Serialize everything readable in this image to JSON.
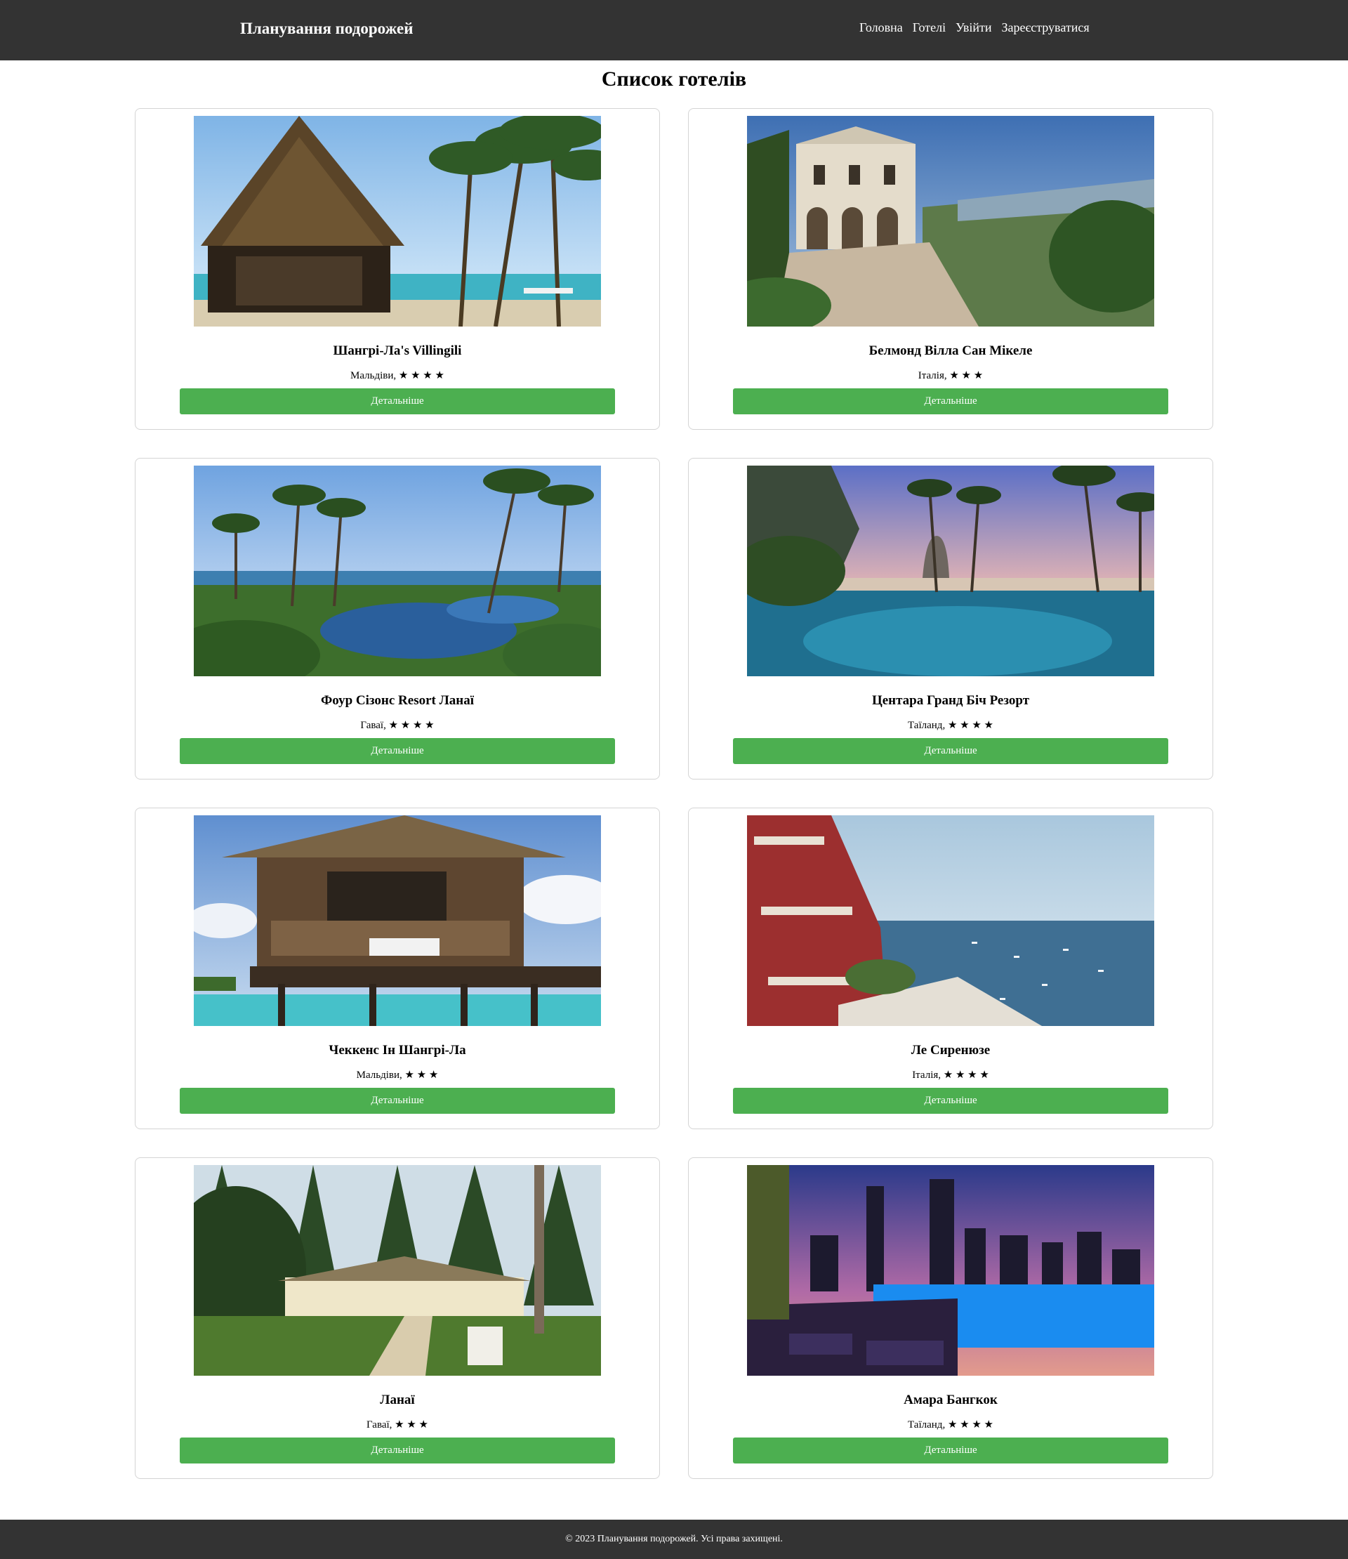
{
  "header": {
    "brand": "Планування подорожей",
    "nav": [
      "Головна",
      "Готелі",
      "Увійти",
      "Зареєструватися"
    ]
  },
  "page_title": "Список готелів",
  "hotels": [
    {
      "name": "Шангрі-Ла's Villingili",
      "country": "Мальдіви",
      "stars": "★ ★ ★ ★",
      "button": "Детальніше",
      "photo": "tropical-beach-palapa-photo"
    },
    {
      "name": "Белмонд Вілла Сан Мікеле",
      "country": "Італія",
      "stars": "★ ★ ★",
      "button": "Детальніше",
      "photo": "italian-villa-photo"
    },
    {
      "name": "Фоур Сізонс Resort Ланаї",
      "country": "Гаваї",
      "stars": "★ ★ ★ ★",
      "button": "Детальніше",
      "photo": "resort-pool-palms-photo"
    },
    {
      "name": "Центара Гранд Біч Резорт",
      "country": "Таїланд",
      "stars": "★ ★ ★ ★",
      "button": "Детальніше",
      "photo": "infinity-pool-sunset-photo"
    },
    {
      "name": "Чеккенс Ін Шангрі-Ла",
      "country": "Мальдіви",
      "stars": "★ ★ ★",
      "button": "Детальніше",
      "photo": "overwater-bungalow-photo"
    },
    {
      "name": "Ле Сиренюзе",
      "country": "Італія",
      "stars": "★ ★ ★ ★",
      "button": "Детальніше",
      "photo": "positano-coast-photo"
    },
    {
      "name": "Ланаї",
      "country": "Гаваї",
      "stars": "★ ★ ★",
      "button": "Детальніше",
      "photo": "pine-forest-lodge-photo"
    },
    {
      "name": "Амара Бангкок",
      "country": "Таїланд",
      "stars": "★ ★ ★ ★",
      "button": "Детальніше",
      "photo": "rooftop-pool-skyline-photo"
    }
  ],
  "footer": "© 2023 Планування подорожей. Усі права захищені."
}
